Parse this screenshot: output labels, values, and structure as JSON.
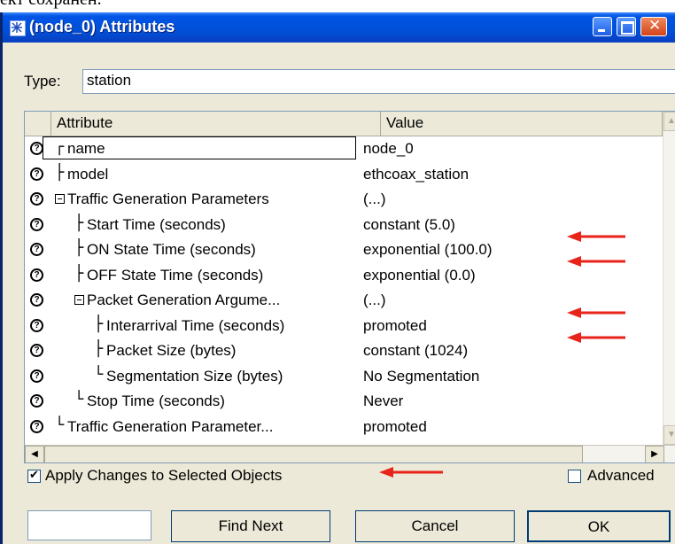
{
  "page_text": "ект сохранен.",
  "window": {
    "title": "(node_0) Attributes",
    "type_label": "Type:",
    "type_value": "station"
  },
  "grid": {
    "header_attribute": "Attribute",
    "header_value": "Value",
    "rows": [
      {
        "tree": "┌",
        "name": "name",
        "value": "node_0"
      },
      {
        "tree": "├",
        "name": "model",
        "value": "ethcoax_station"
      },
      {
        "tree": "⊟",
        "name": "Traffic Generation Parameters",
        "value": "(...)"
      },
      {
        "tree": "├",
        "name": "Start Time (seconds)",
        "value": "constant (5.0)"
      },
      {
        "tree": "├",
        "name": "ON State Time (seconds)",
        "value": "exponential (100.0)"
      },
      {
        "tree": "├",
        "name": "OFF State Time (seconds)",
        "value": "exponential (0.0)"
      },
      {
        "tree": "⊟",
        "name": "Packet Generation Argume...",
        "value": "(...)"
      },
      {
        "tree": "├",
        "name": "Interarrival Time (seconds)",
        "value": "promoted"
      },
      {
        "tree": "├",
        "name": "Packet Size (bytes)",
        "value": "constant (1024)"
      },
      {
        "tree": "└",
        "name": "Segmentation Size (bytes)",
        "value": "No Segmentation"
      },
      {
        "tree": "└",
        "name": "Stop Time (seconds)",
        "value": "Never"
      },
      {
        "tree": "└",
        "name": "Traffic Generation Parameter...",
        "value": "promoted"
      }
    ]
  },
  "apply_changes": {
    "label": "Apply Changes to Selected Objects",
    "checked": true
  },
  "advanced": {
    "label": "Advanced",
    "checked": false
  },
  "buttons": {
    "find_next": "Find Next",
    "cancel": "Cancel",
    "ok": "OK"
  },
  "arrow_color": "#e8231a",
  "title_color": "#0055e5"
}
